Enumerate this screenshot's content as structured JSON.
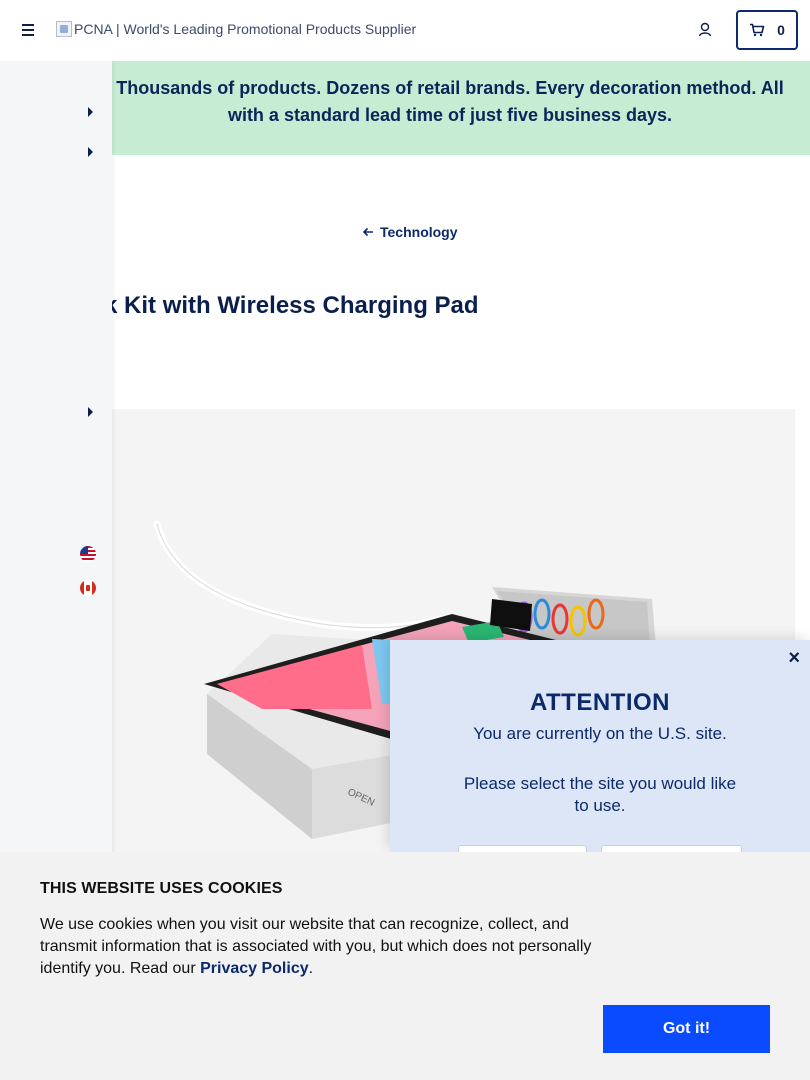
{
  "header": {
    "logo_alt": "PCNA | World's Leading Promotional Products Supplier",
    "cart_count": "0"
  },
  "banner": {
    "text": "Thousands of products. Dozens of retail brands. Every decoration method. All with a standard lead time of just five business days."
  },
  "breadcrumb": {
    "back_label": "Technology"
  },
  "product": {
    "title": "Desk Kit with Wireless Charging Pad"
  },
  "site_modal": {
    "heading": "ATTENTION",
    "current_site": "You are currently on the U.S. site.",
    "prompt": "Please select the site you would like to use.",
    "close_glyph": "×"
  },
  "cookie_banner": {
    "heading": "THIS WEBSITE USES COOKIES",
    "body_text": "We use cookies when you visit our website that can recognize, collect, and transmit information that is associated with you, but which does not personally identify you. Read our ",
    "policy_link": "Privacy Policy",
    "trailing": ".",
    "accept_label": "Got it!"
  },
  "icons": {
    "menu": "hamburger-icon",
    "account": "user-icon",
    "cart": "cart-icon",
    "back": "arrow-left-icon",
    "close": "close-icon",
    "flag_us": "us-flag-icon",
    "flag_ca": "canada-flag-icon"
  },
  "colors": {
    "navy": "#0b1f4d",
    "banner_green": "#c6ecd3",
    "modal_blue": "#dde6f6",
    "accept_button": "#0a4bff"
  }
}
